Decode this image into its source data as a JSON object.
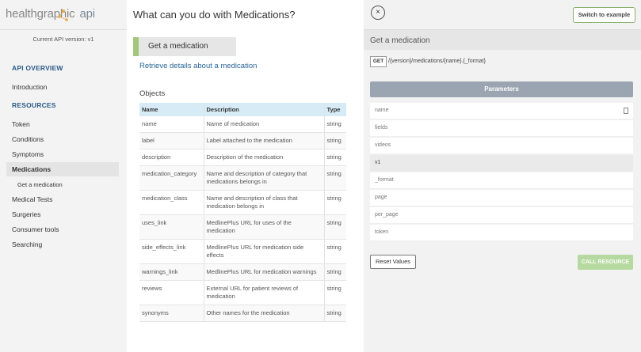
{
  "logo": {
    "brand": "healthgraphic",
    "api": "api"
  },
  "sidebar": {
    "version": "Current API version: v1",
    "api_overview": "API OVERVIEW",
    "introduction": "Introduction",
    "resources": "RESOURCES",
    "items": [
      "Token",
      "Conditions",
      "Symptoms",
      "Medications",
      "Medical Tests",
      "Surgeries",
      "Consumer tools",
      "Searching"
    ],
    "sub_item": "Get a medication"
  },
  "main": {
    "title": "What can you do with Medications?",
    "card_label": "Get a medication",
    "link": "Retrieve details about a medication",
    "objects_label": "Objects",
    "columns": [
      "Name",
      "Description",
      "Type"
    ],
    "rows": [
      {
        "name": "name",
        "description": "Name of medication",
        "type": "string"
      },
      {
        "name": "label",
        "description": "Label attached to the medication",
        "type": "string"
      },
      {
        "name": "description",
        "description": "Description of the medication",
        "type": "string"
      },
      {
        "name": "medication_category",
        "description": "Name and description of category that medications belongs in",
        "type": "string"
      },
      {
        "name": "medication_class",
        "description": "Name and description of class that medication belongs in",
        "type": "string"
      },
      {
        "name": "uses_link",
        "description": "MedlinePlus URL for uses of the medication",
        "type": "string"
      },
      {
        "name": "side_effects_link",
        "description": "MedlinePlus URL for medication side effects",
        "type": "string"
      },
      {
        "name": "warnings_link",
        "description": "MedlinePlus URL for medication warnings",
        "type": "string"
      },
      {
        "name": "reviews",
        "description": "External URL for patient reviews of medication",
        "type": "string"
      },
      {
        "name": "synonyms",
        "description": "Other names for the medication",
        "type": "string"
      }
    ]
  },
  "panel": {
    "close_icon": "×",
    "switch_label": "Switch to example",
    "header": "Get a medication",
    "method": "GET",
    "endpoint": "/{version}/medications/{name}.{_format}",
    "params_label": "Parameters",
    "params": [
      {
        "placeholder": "name",
        "value": ""
      },
      {
        "placeholder": "fields",
        "value": ""
      },
      {
        "placeholder": "videos",
        "value": ""
      },
      {
        "placeholder": "",
        "value": "v1"
      },
      {
        "placeholder": "_format",
        "value": ""
      },
      {
        "placeholder": "page",
        "value": ""
      },
      {
        "placeholder": "per_page",
        "value": ""
      },
      {
        "placeholder": "token",
        "value": ""
      }
    ],
    "reset_label": "Reset Values",
    "call_label": "CALL RESOURCE"
  },
  "colors": {
    "accent_green": "#a4c67c",
    "link_blue": "#2a6596",
    "table_header": "#d7ebf6",
    "params_bar": "#9aa5b1"
  }
}
